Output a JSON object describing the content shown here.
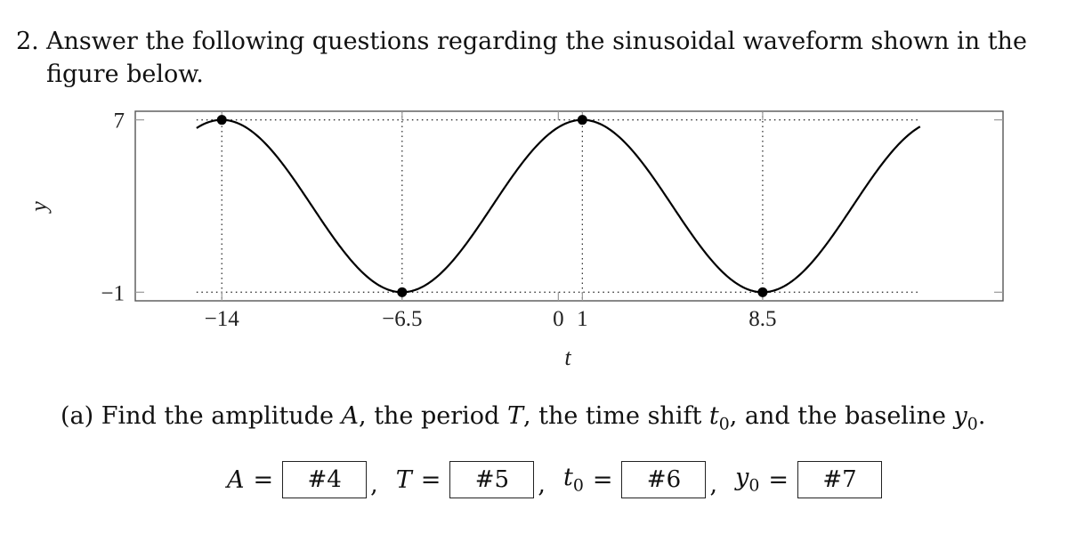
{
  "problem": {
    "number": "2.",
    "text_line1": "Answer the following questions regarding the sinusoidal waveform shown in the",
    "text_line2": "figure below."
  },
  "chart_data": {
    "type": "line",
    "title": "",
    "xlabel": "t",
    "ylabel": "y",
    "xlim": [
      -17.6,
      18.5
    ],
    "ylim": [
      -1.4,
      7.4
    ],
    "grid": false,
    "function": {
      "form": "y = A cos(2π (t - t0) / T) + y0",
      "A": 4,
      "T": 15,
      "t0": 1,
      "y0": 3
    },
    "curve_domain": [
      -15.05,
      15.05
    ],
    "x_ticks": [
      {
        "value": -14,
        "label": "−14"
      },
      {
        "value": -6.5,
        "label": "−6.5"
      },
      {
        "value": 0,
        "label": "0"
      },
      {
        "value": 1,
        "label": "1"
      },
      {
        "value": 8.5,
        "label": "8.5"
      }
    ],
    "y_ticks": [
      {
        "value": 7,
        "label": "7"
      },
      {
        "value": -1,
        "label": "−1"
      }
    ],
    "marked_points": [
      {
        "t": -14,
        "y": 7
      },
      {
        "t": -6.5,
        "y": -1
      },
      {
        "t": 1,
        "y": 7
      },
      {
        "t": 8.5,
        "y": -1
      }
    ],
    "guide_lines": {
      "vertical_at_t": [
        -14,
        -6.5,
        1,
        8.5
      ],
      "horizontal_at_y": [
        7,
        -1
      ]
    }
  },
  "question": {
    "label": "(a)",
    "text_before_A": "Find the amplitude ",
    "A": "A",
    "text_before_T": ", the period ",
    "T": "T",
    "text_before_t0": ", the time shift ",
    "t0_base": "t",
    "t0_sub": "0",
    "text_before_y0": ", and the baseline ",
    "y0_base": "y",
    "y0_sub": "0",
    "end": "."
  },
  "answers": [
    {
      "var": "A",
      "sub": "",
      "placeholder": "#4"
    },
    {
      "var": "T",
      "sub": "",
      "placeholder": "#5"
    },
    {
      "var": "t",
      "sub": "0",
      "placeholder": "#6"
    },
    {
      "var": "y",
      "sub": "0",
      "placeholder": "#7"
    }
  ],
  "equals": "=",
  "comma": ","
}
